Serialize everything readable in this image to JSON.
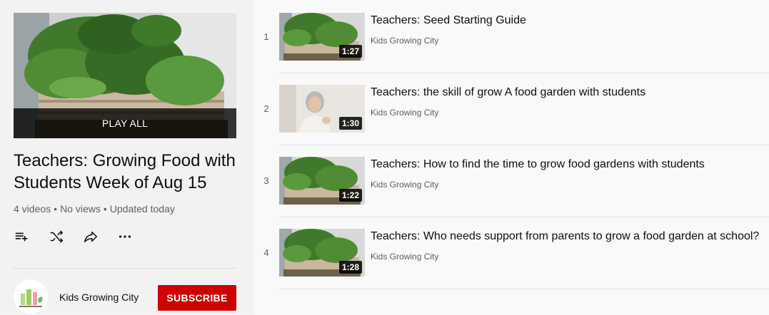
{
  "playlist": {
    "play_all_label": "PLAY ALL",
    "title": "Teachers: Growing Food with Students Week of Aug 15",
    "meta": {
      "video_count": "4 videos",
      "views": "No views",
      "updated": "Updated today"
    },
    "actions": [
      {
        "name": "save-to-playlist-icon"
      },
      {
        "name": "shuffle-icon"
      },
      {
        "name": "share-icon"
      },
      {
        "name": "more-options-icon"
      }
    ],
    "channel": {
      "name": "Kids Growing City",
      "subscribe_label": "SUBSCRIBE"
    }
  },
  "videos": [
    {
      "index": "1",
      "title": "Teachers: Seed Starting Guide",
      "channel": "Kids Growing City",
      "duration": "1:27",
      "thumb": "garden"
    },
    {
      "index": "2",
      "title": "Teachers: the skill of grow A food garden with students",
      "channel": "Kids Growing City",
      "duration": "1:30",
      "thumb": "person"
    },
    {
      "index": "3",
      "title": "Teachers: How to find the time to grow food gardens with students",
      "channel": "Kids Growing City",
      "duration": "1:22",
      "thumb": "garden"
    },
    {
      "index": "4",
      "title": "Teachers: Who needs support from parents to grow a food garden at school?",
      "channel": "Kids Growing City",
      "duration": "1:28",
      "thumb": "garden"
    }
  ],
  "colors": {
    "subscribe": "#cc0000",
    "sidebar_bg": "#f2f2f2",
    "page_bg": "#f9f9f9"
  }
}
